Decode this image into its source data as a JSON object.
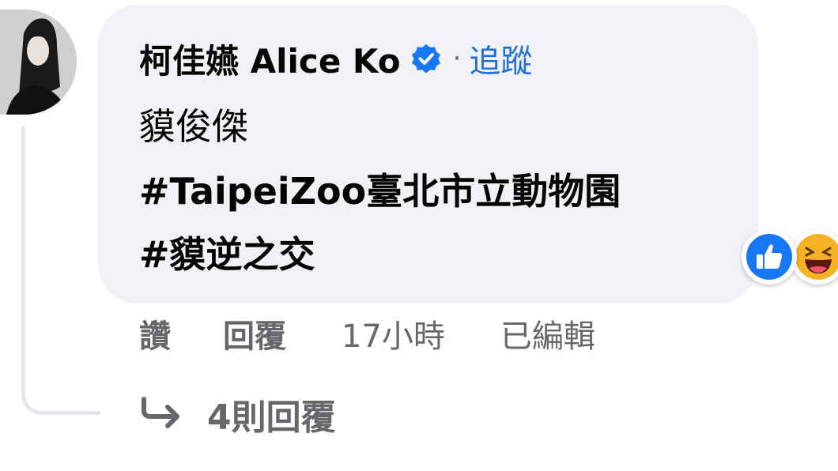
{
  "comment": {
    "author": "柯佳嬿 Alice Ko",
    "separator": "·",
    "follow": "追蹤",
    "lines": [
      "貘俊傑",
      "#TaipeiZoo臺北市立動物園",
      "#貘逆之交"
    ]
  },
  "reactions": {
    "icons": [
      "like-icon",
      "haha-icon"
    ]
  },
  "actions": {
    "like": "讚",
    "reply": "回覆",
    "timestamp": "17小時",
    "edited": "已編輯"
  },
  "view_replies": {
    "label": "4則回覆",
    "icon": "reply-arrow-icon"
  },
  "colors": {
    "bubble": "#f0f2f5",
    "link": "#216fdb",
    "verified": "#1877f2",
    "secondary_text": "#65676b",
    "like": "#1877f2",
    "haha": "#f7b125"
  }
}
